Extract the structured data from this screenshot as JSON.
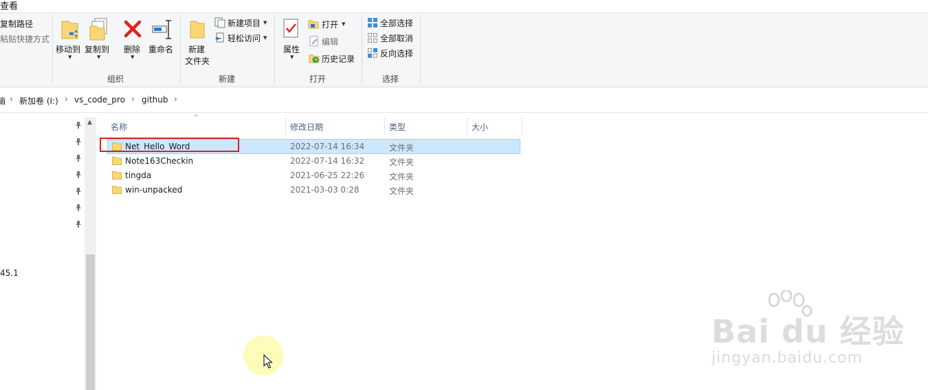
{
  "tabs": {
    "view": "查看"
  },
  "ribbon": {
    "clipboard": {
      "copy_path": "复制路径",
      "paste_shortcut": "粘贴快捷方式"
    },
    "organize": {
      "label": "组织",
      "move_to": "移动到",
      "copy_to": "复制到",
      "delete": "删除",
      "rename": "重命名"
    },
    "new": {
      "label": "新建",
      "new_folder_line1": "新建",
      "new_folder_line2": "文件夹",
      "new_item": "新建项目",
      "easy_access": "轻松访问"
    },
    "open": {
      "label": "打开",
      "properties": "属性",
      "open": "打开",
      "edit": "编辑",
      "history": "历史记录"
    },
    "select": {
      "label": "选择",
      "select_all": "全部选择",
      "select_none": "全部取消",
      "invert": "反向选择"
    }
  },
  "address": {
    "crumbs": [
      "脑",
      "新加卷 (I:)",
      "vs_code_pro",
      "github"
    ]
  },
  "nav": {
    "partial_item": "45.1"
  },
  "columns": {
    "name": "名称",
    "date": "修改日期",
    "type": "类型",
    "size": "大小"
  },
  "files": [
    {
      "name": "Net_Hello_Word",
      "date": "2022-07-14 16:34",
      "type": "文件夹",
      "selected": true
    },
    {
      "name": "Note163Checkin",
      "date": "2022-07-14 16:32",
      "type": "文件夹",
      "selected": false
    },
    {
      "name": "tingda",
      "date": "2021-06-25 22:26",
      "type": "文件夹",
      "selected": false
    },
    {
      "name": "win-unpacked",
      "date": "2021-03-03 0:28",
      "type": "文件夹",
      "selected": false
    }
  ],
  "watermark": {
    "brand": "Bai du 经验",
    "url": "jingyan.baidu.com"
  },
  "colors": {
    "selection": "#cce8ff",
    "highlight_box": "#e02020",
    "folder": "#f8d775"
  }
}
